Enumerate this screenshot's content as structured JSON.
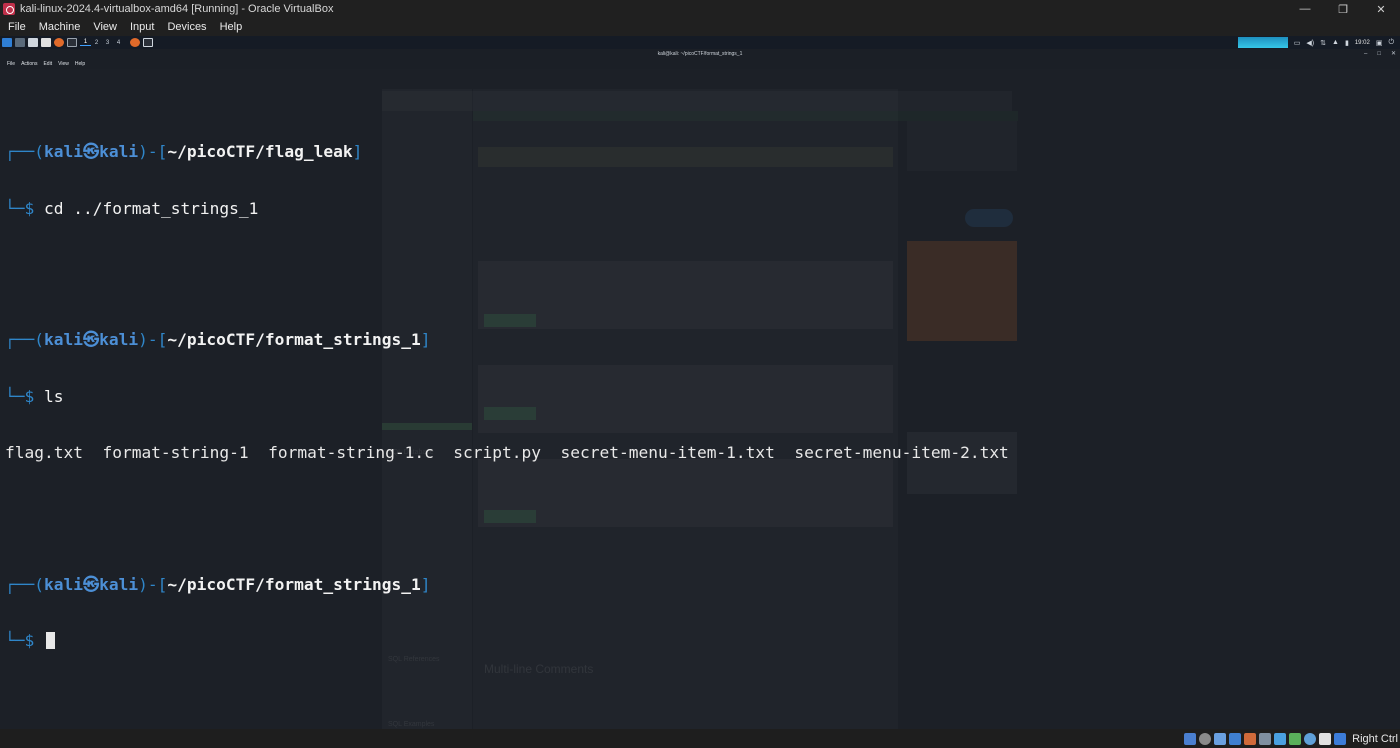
{
  "window": {
    "title": "kali-linux-2024.4-virtualbox-amd64 [Running] - Oracle VirtualBox",
    "controls": [
      "—",
      "❐",
      "✕"
    ]
  },
  "vb_menu": [
    "File",
    "Machine",
    "View",
    "Input",
    "Devices",
    "Help"
  ],
  "kali_panel": {
    "workspaces": [
      "1",
      "2",
      "3",
      "4"
    ],
    "active_workspace": "1",
    "clock": "19:02"
  },
  "terminal": {
    "title": "kali@kali: ~/picoCTF/format_strings_1",
    "menu": [
      "File",
      "Actions",
      "Edit",
      "View",
      "Help"
    ],
    "prompt_user": "kali",
    "prompt_at": "㉿",
    "prompt_host": "kali",
    "sessions": [
      {
        "path": "~/picoCTF/flag_leak",
        "command": "cd ../format_strings_1",
        "output": ""
      },
      {
        "path": "~/picoCTF/format_strings_1",
        "command": "ls",
        "output": "flag.txt  format-string-1  format-string-1.c  script.py  secret-menu-item-1.txt  secret-menu-item-2.txt"
      },
      {
        "path": "~/picoCTF/format_strings_1",
        "command": "",
        "output": ""
      }
    ]
  },
  "background_ghost": {
    "side_heads": [
      "SQL Database",
      "SQL References",
      "SQL Examples"
    ],
    "heading": "Multi-line Comments"
  },
  "status_bar": {
    "host_key": "Right Ctrl"
  }
}
